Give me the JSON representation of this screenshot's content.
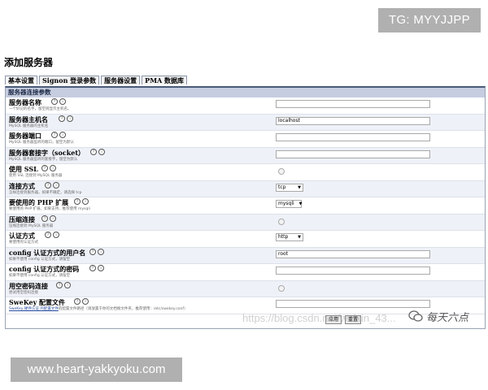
{
  "watermarks": {
    "top": "TG: MYYJJPP",
    "bottom": "www.heart-yakkyoku.com",
    "csdn": "https://blog.csdn.net/weixin_43...",
    "wechat": "每天六点"
  },
  "page": {
    "title": "添加服务器"
  },
  "tabs": [
    {
      "label": "基本设置"
    },
    {
      "label": "Signon 登录参数"
    },
    {
      "label": "服务器设置"
    },
    {
      "label": "PMA 数据库"
    }
  ],
  "section": {
    "title": "服务器连接参数"
  },
  "fields": [
    {
      "label": "服务器名称",
      "desc": "一个好记的名字，留空则显示主机名。",
      "control": "text",
      "value": ""
    },
    {
      "label": "服务器主机名",
      "desc": "MySQL 服务器的主机名",
      "control": "text",
      "value": "localhost"
    },
    {
      "label": "服务器端口",
      "desc": "MySQL 服务器监听的端口，留空为默认",
      "control": "text",
      "value": ""
    },
    {
      "label": "服务器套接字（socket）",
      "desc": "MySQL 服务器监听的套接字，留空为默认",
      "control": "text",
      "value": ""
    },
    {
      "label": "使用 SSL",
      "desc": "使用 SSL 连接到 MySQL 服务器",
      "control": "checkbox",
      "value": ""
    },
    {
      "label": "连接方式",
      "desc": "怎样连接到服务器，如果不确定，请选择 tcp",
      "control": "select",
      "value": "tcp"
    },
    {
      "label": "要使用的 PHP 扩展",
      "desc": "要使用的 PHP 扩展，如果支持，推荐使用 mysqli",
      "control": "select",
      "value": "mysqli"
    },
    {
      "label": "压缩连接",
      "desc": "压缩连接到 MySQL 服务器",
      "control": "checkbox",
      "value": ""
    },
    {
      "label": "认证方式",
      "desc": "要使用的认证方式",
      "control": "select",
      "value": "http"
    },
    {
      "label": "config 认证方式的用户名",
      "desc": "如果不使用 config 认证方式，请留空",
      "control": "text",
      "value": "root"
    },
    {
      "label": "config 认证方式的密码",
      "desc": "如果不使用 config 认证方式，请留空",
      "control": "text",
      "value": ""
    },
    {
      "label": "用空密码连接",
      "desc": "尝试用空密码连接",
      "control": "checkbox",
      "value": ""
    },
    {
      "label": "SweKey 配置文件",
      "desc_link": "SweKey 硬件认证 的配置文件",
      "desc": "的配置文件路径（请放置于你的文档根文件夹，推荐使用：/etc/swekey.conf）",
      "control": "text",
      "value": ""
    }
  ],
  "buttons": {
    "apply": "应用",
    "reset": "重置"
  }
}
